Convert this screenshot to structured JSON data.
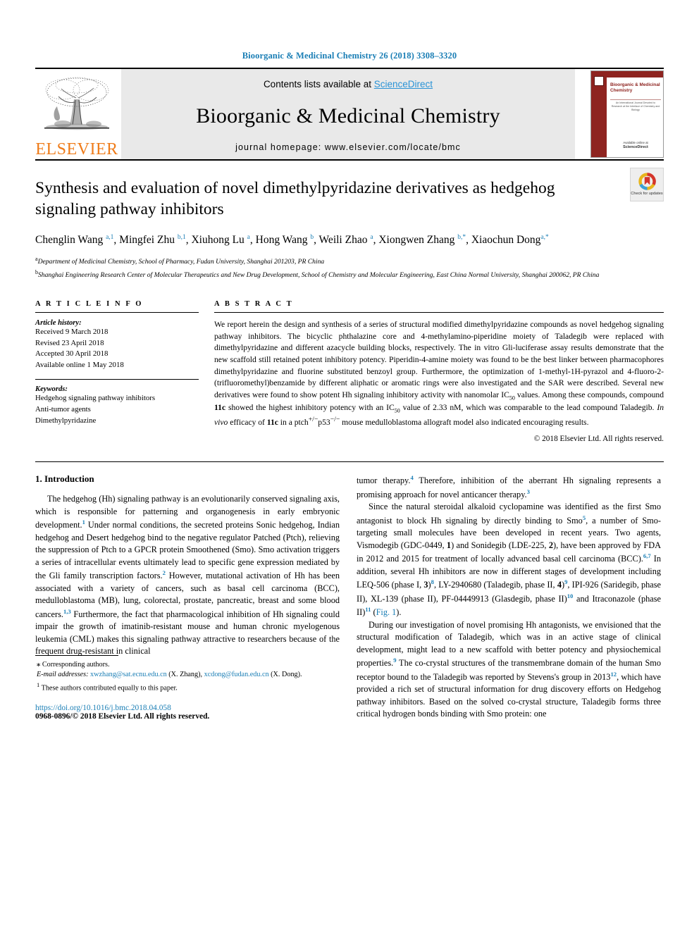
{
  "running_head": "Bioorganic & Medicinal Chemistry 26 (2018) 3308–3320",
  "masthead": {
    "contents_prefix": "Contents lists available at ",
    "sciencedirect": "ScienceDirect",
    "journal_title": "Bioorganic & Medicinal Chemistry",
    "homepage": "journal homepage: www.elsevier.com/locate/bmc",
    "publisher_logo_text": "ELSEVIER",
    "cover": {
      "title": "Bioorganic & Medicinal Chemistry",
      "subtitle": "An International Journal Devoted to Research at the Interface of Chemistry and Biology",
      "bottom_label": "Available online at",
      "bottom_brand": "ScienceDirect"
    },
    "accent_blue": "#2a93d6",
    "elsevier_orange": "#ef7c1a"
  },
  "article": {
    "title": "Synthesis and evaluation of novel dimethylpyridazine derivatives as hedgehog signaling pathway inhibitors",
    "crossmark_label": "Check for updates",
    "authors_html": "Chenglin Wang <sup>a,1</sup>, Mingfei Zhu <sup>b,1</sup>, Xiuhong Lu <sup>a</sup>, Hong Wang <sup>b</sup>, Weili Zhao <sup>a</sup>, Xiongwen Zhang <sup>b,</sup><sup>*</sup>, Xiaochun Dong<sup>a,</sup><sup>*</sup>",
    "affiliations": [
      {
        "marker": "a",
        "text": "Department of Medicinal Chemistry, School of Pharmacy, Fudan University, Shanghai 201203, PR China"
      },
      {
        "marker": "b",
        "text": "Shanghai Engineering Research Center of Molecular Therapeutics and New Drug Development, School of Chemistry and Molecular Engineering, East China Normal University, Shanghai 200062, PR China"
      }
    ]
  },
  "article_info": {
    "heading": "A R T I C L E   I N F O",
    "history_label": "Article history:",
    "history": [
      "Received 9 March 2018",
      "Revised 23 April 2018",
      "Accepted 30 April 2018",
      "Available online 1 May 2018"
    ],
    "keywords_label": "Keywords:",
    "keywords": [
      "Hedgehog signaling pathway inhibitors",
      "Anti-tumor agents",
      "Dimethylpyridazine"
    ]
  },
  "abstract": {
    "heading": "A B S T R A C T",
    "paragraph_html": "We report herein the design and synthesis of a series of structural modified dimethylpyridazine compounds as novel hedgehog signaling pathway inhibitors. The bicyclic phthalazine core and 4-methylamino-piperidine moiety of Taladegib were replaced with dimethylpyridazine and different azacycle building blocks, respectively. The in vitro Gli-luciferase assay results demonstrate that the new scaffold still retained potent inhibitory potency. Piperidin-4-amine moiety was found to be the best linker between pharmacophores dimethylpyridazine and fluorine substituted benzoyl group. Furthermore, the optimization of 1-methyl-1H-pyrazol and 4-fluoro-2-(trifluoromethyl)benzamide by different aliphatic or aromatic rings were also investigated and the SAR were described. Several new derivatives were found to show potent Hh signaling inhibitory activity with nanomolar IC<sub>50</sub> values. Among these compounds, compound <b>11c</b> showed the highest inhibitory potency with an IC<sub>50</sub> value of 2.33 nM, which was comparable to the lead compound Taladegib. <i>In vivo</i> efficacy of <b>11c</b> in a ptch<sup>+/−</sup>p53<sup>−/−</sup> mouse medulloblastoma allograft model also indicated encouraging results.",
    "copyright": "© 2018 Elsevier Ltd. All rights reserved."
  },
  "body": {
    "section_heading": "1. Introduction",
    "left_paragraph_html": "The hedgehog (Hh) signaling pathway is an evolutionarily conserved signaling axis, which is responsible for patterning and organogenesis in early embryonic development.<sup class=\"ref\">1</sup> Under normal conditions, the secreted proteins Sonic hedgehog, Indian hedgehog and Desert hedgehog bind to the negative regulator Patched (Ptch), relieving the suppression of Ptch to a GPCR protein Smoothened (Smo). Smo activation triggers a series of intracellular events ultimately lead to specific gene expression mediated by the Gli family transcription factors.<sup class=\"ref\">2</sup> However, mutational activation of Hh has been associated with a variety of cancers, such as basal cell carcinoma (BCC), medulloblastoma (MB), lung, colorectal, prostate, pancreatic, breast and some blood cancers.<sup class=\"ref\">1,3</sup> Furthermore, the fact that pharmacological inhibition of Hh signaling could impair the growth of imatinib-resistant mouse and human chronic myelogenous leukemia (CML) makes this signaling pathway attractive to researchers because of the frequent drug-resistant in clinical",
    "right_paragraph_1_html": "tumor therapy.<sup class=\"ref\">4</sup> Therefore, inhibition of the aberrant Hh signaling represents a promising approach for novel anticancer therapy.<sup class=\"ref\">3</sup>",
    "right_paragraph_2_html": "Since the natural steroidal alkaloid cyclopamine was identified as the first Smo antagonist to block Hh signaling by directly binding to Smo<sup class=\"ref\">5</sup>, a number of Smo-targeting small molecules have been developed in recent years. Two agents, Vismodegib (GDC-0449, <b>1</b>) and Sonidegib (LDE-225, <b>2</b>), have been approved by FDA in 2012 and 2015 for treatment of locally advanced basal cell carcinoma (BCC).<sup class=\"ref\">6,7</sup> In addition, several Hh inhibitors are now in different stages of development including LEQ-506 (phase I, <b>3</b>)<sup class=\"ref\">8</sup>, LY-2940680 (Taladegib, phase II, <b>4</b>)<sup class=\"ref\">9</sup>, IPI-926 (Saridegib, phase II), XL-139 (phase II), PF-04449913 (Glasdegib, phase II)<sup class=\"ref\">10</sup> and Itraconazole (phase II)<sup class=\"ref\">11</sup> (<span class=\"figlink\">Fig. 1</span>).",
    "right_paragraph_3_html": "During our investigation of novel promising Hh antagonists, we envisioned that the structural modification of Taladegib, which was in an active stage of clinical development, might lead to a new scaffold with better potency and physiochemical properties.<sup class=\"ref\">9</sup> The co-crystal structures of the transmembrane domain of the human Smo receptor bound to the Taladegib was reported by Stevens's group in 2013<sup class=\"ref\">12</sup>, which have provided a rich set of structural information for drug discovery efforts on Hedgehog pathway inhibitors. Based on the solved co-crystal structure, Taladegib forms three critical hydrogen bonds binding with Smo protein: one"
  },
  "footnotes": {
    "corresponding_html": "<b>⁎</b> Corresponding authors.",
    "email_html": "<i>E-mail addresses:</i> <span class=\"link\">xwzhang@sat.ecnu.edu.cn</span> (X. Zhang), <span class=\"link\">xcdong@fudan.edu.cn</span> (X. Dong).",
    "equal_contrib_html": "<sup>1</sup> These authors contributed equally to this paper.",
    "doi": "https://doi.org/10.1016/j.bmc.2018.04.058",
    "issn_line": "0968-0896/© 2018 Elsevier Ltd. All rights reserved."
  }
}
